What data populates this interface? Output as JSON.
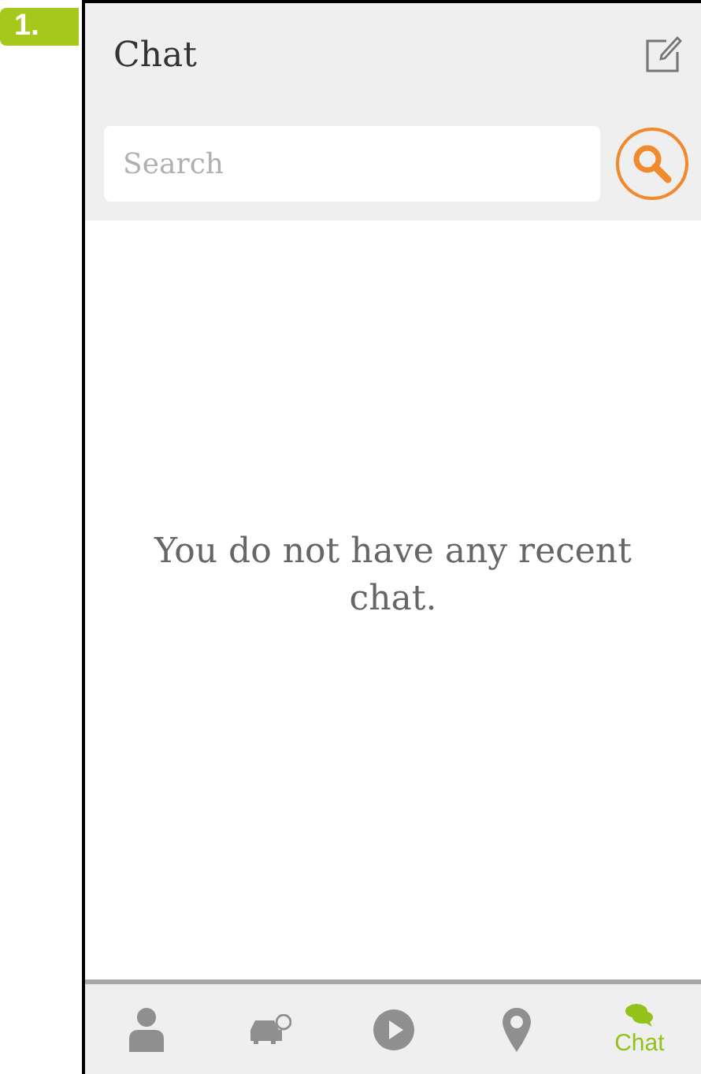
{
  "step_badge": "1.",
  "header": {
    "title": "Chat"
  },
  "search": {
    "placeholder": "Search"
  },
  "empty_message": "You do not have any recent chat.",
  "tabs": [
    {
      "kind": "person",
      "selected": false
    },
    {
      "kind": "car",
      "selected": false
    },
    {
      "kind": "play",
      "selected": false
    },
    {
      "kind": "pin",
      "selected": false
    },
    {
      "kind": "chat",
      "selected": true,
      "label": "Chat"
    }
  ]
}
